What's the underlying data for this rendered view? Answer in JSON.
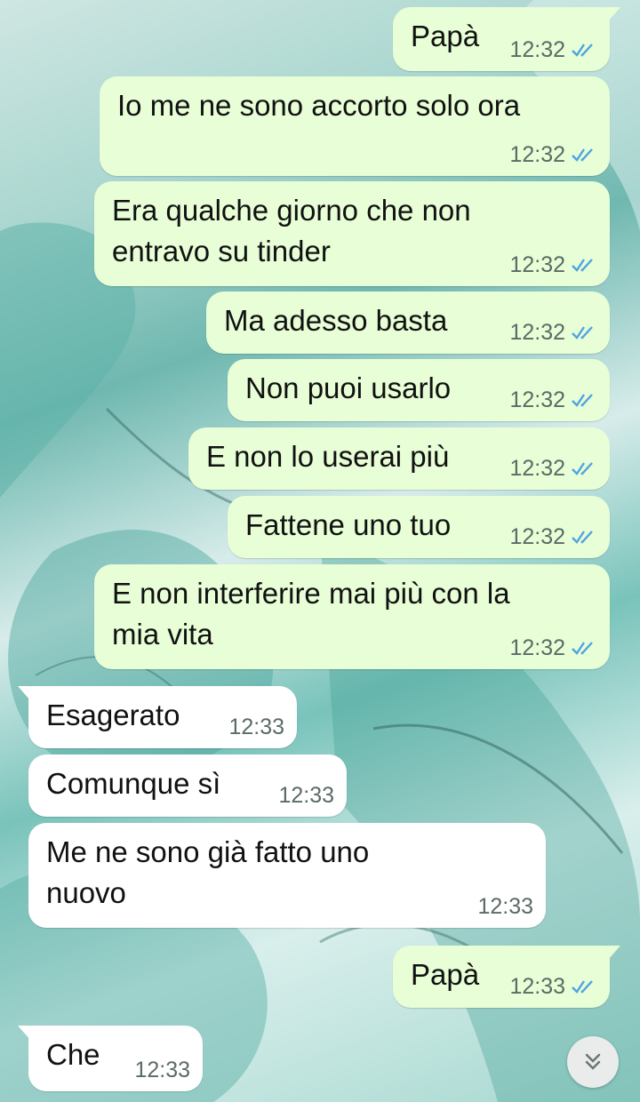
{
  "messages": [
    {
      "dir": "out",
      "text": "Papà",
      "time": "12:32",
      "status": "read"
    },
    {
      "dir": "out",
      "text": "Io me ne sono accorto solo ora",
      "time": "12:32",
      "status": "read"
    },
    {
      "dir": "out",
      "text": "Era qualche giorno che non\nentravo su tinder",
      "time": "12:32",
      "status": "read"
    },
    {
      "dir": "out",
      "text": "Ma adesso basta",
      "time": "12:32",
      "status": "read"
    },
    {
      "dir": "out",
      "text": "Non puoi usarlo",
      "time": "12:32",
      "status": "read"
    },
    {
      "dir": "out",
      "text": "E non lo userai più",
      "time": "12:32",
      "status": "read"
    },
    {
      "dir": "out",
      "text": "Fattene uno tuo",
      "time": "12:32",
      "status": "read"
    },
    {
      "dir": "out",
      "text": "E non interferire mai più con la\nmia vita",
      "time": "12:32",
      "status": "read"
    },
    {
      "dir": "in",
      "text": "Esagerato",
      "time": "12:33"
    },
    {
      "dir": "in",
      "text": "Comunque sì",
      "time": "12:33"
    },
    {
      "dir": "in",
      "text": "Me ne sono già fatto uno\nnuovo",
      "time": "12:33"
    },
    {
      "dir": "out",
      "text": "Papà",
      "time": "12:33",
      "status": "read"
    },
    {
      "dir": "in",
      "text": "Che",
      "time": "12:33"
    }
  ],
  "colors": {
    "outgoing_bubble": "#e7fed6",
    "incoming_bubble": "#ffffff",
    "read_ticks": "#4fa3e0",
    "timestamp": "#5b6b66"
  },
  "icons": {
    "read_receipt": "double-check-icon",
    "scroll_down": "double-chevron-down-icon"
  }
}
